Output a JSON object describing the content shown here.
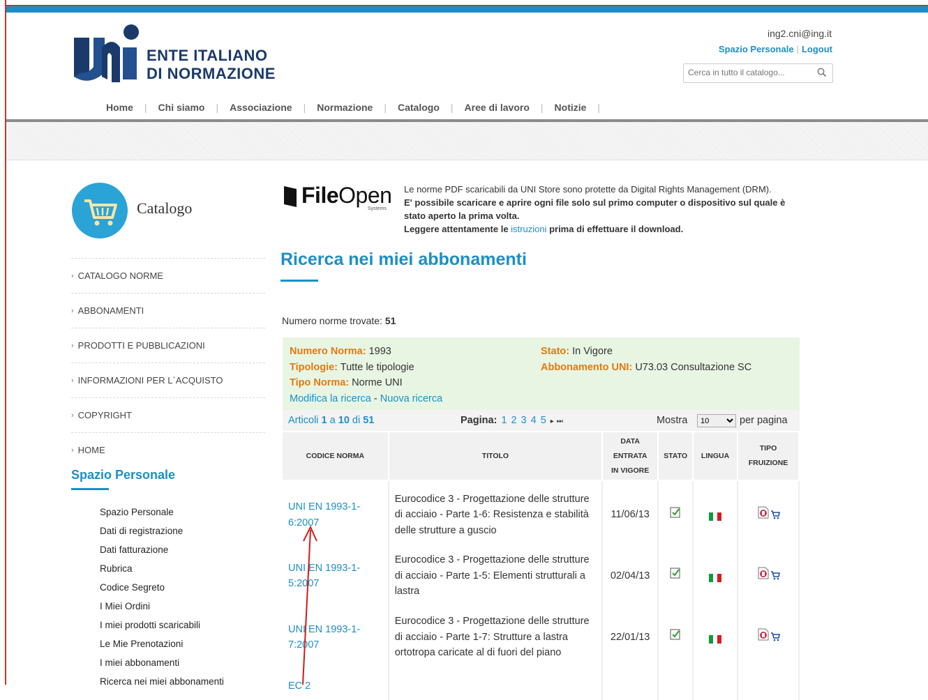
{
  "header": {
    "logo_text_line1": "ENTE ITALIANO",
    "logo_text_line2": "DI NORMAZIONE",
    "user_email": "ing2.cni@ing.it",
    "link_personal": "Spazio Personale",
    "link_logout": "Logout",
    "search_placeholder": "Cerca in tutto il catalogo..."
  },
  "nav": [
    "Home",
    "Chi siamo",
    "Associazione",
    "Normazione",
    "Catalogo",
    "Aree di lavoro",
    "Notizie"
  ],
  "sidebar": {
    "title": "Catalogo",
    "menu": [
      "CATALOGO NORME",
      "ABBONAMENTI",
      "PRODOTTI E PUBBLICAZIONI",
      "INFORMAZIONI PER L`ACQUISTO",
      "COPYRIGHT",
      "HOME"
    ],
    "personal_title": "Spazio Personale",
    "personal_items": [
      "Spazio Personale",
      "Dati di registrazione",
      "Dati fatturazione",
      "Rubrica",
      "Codice Segreto",
      "I Miei Ordini",
      "I miei prodotti scaricabili",
      "Le Mie Prenotazioni",
      "I miei abbonamenti",
      "Ricerca nei miei abbonamenti"
    ]
  },
  "drm": {
    "brand": "FileOpen",
    "brand_bold": "File",
    "brand_rest": "Open",
    "brand_sub": "Systems",
    "line1": "Le norme PDF scaricabili da UNI Store sono protette da Digital Rights Management (DRM).",
    "line2": "E' possibile scaricare e aprire ogni file solo sul primo computer o dispositivo sul quale è stato aperto la prima volta.",
    "line3_pre": "Leggere attentamente le ",
    "line3_link": "istruzioni",
    "line3_post": " prima di effettuare il download."
  },
  "main": {
    "title": "Ricerca nei miei abbonamenti",
    "found_label": "Numero norme trovate: ",
    "found_count": "51",
    "filters": {
      "numero_label": "Numero Norma:",
      "numero_value": " 1993",
      "tipologie_label": "Tipologie:",
      "tipologie_value": " Tutte le tipologie",
      "tipo_label": "Tipo Norma:",
      "tipo_value": " Norme UNI",
      "stato_label": "Stato:",
      "stato_value": " In Vigore",
      "abb_label": "Abbonamento UNI:",
      "abb_value": " U73.03 Consultazione SC",
      "modify": "Modifica la ricerca",
      "dash": " - ",
      "new": "Nuova ricerca"
    },
    "pager": {
      "articoli": "Articoli ",
      "from": "1",
      "a": " a ",
      "to": "10",
      "di": " di ",
      "total": "51",
      "pagina": "Pagina:",
      "pages": [
        "1",
        "2",
        "3",
        "4",
        "5",
        "▸",
        "⏭"
      ],
      "mostra": "Mostra",
      "per_page": "10",
      "per_pagina": "per pagina"
    },
    "table": {
      "headers": [
        "CODICE NORMA",
        "TITOLO",
        "DATA ENTRATA IN VIGORE",
        "STATO",
        "LINGUA",
        "TIPO FRUIZIONE"
      ],
      "header_date_lines": [
        "DATA",
        "ENTRATA",
        "IN VIGORE"
      ],
      "header_tipo_lines": [
        "TIPO",
        "FRUIZIONE"
      ],
      "rows": [
        {
          "code": "UNI EN 1993-1-6:2007",
          "title": "Eurocodice 3 - Progettazione delle strutture di acciaio - Parte 1-6: Resistenza e stabilità delle strutture a guscio",
          "date": "11/06/13"
        },
        {
          "code": "UNI EN 1993-1-5:2007",
          "title": "Eurocodice 3 - Progettazione delle strutture di acciaio - Parte 1-5: Elementi strutturali a lastra",
          "date": "02/04/13"
        },
        {
          "code": "UNI EN 1993-1-7:2007",
          "title": "Eurocodice 3 - Progettazione delle strutture di acciaio - Parte 1-7: Strutture a lastra ortotropa caricate al di fuori del piano",
          "date": "22/01/13"
        },
        {
          "code": "EC 2",
          "title": "",
          "date": ""
        }
      ]
    }
  },
  "colors": {
    "accent": "#1a8fc7",
    "orange": "#e07a10",
    "filter_bg": "#e8f5e3",
    "annotation": "#d11a1a"
  }
}
